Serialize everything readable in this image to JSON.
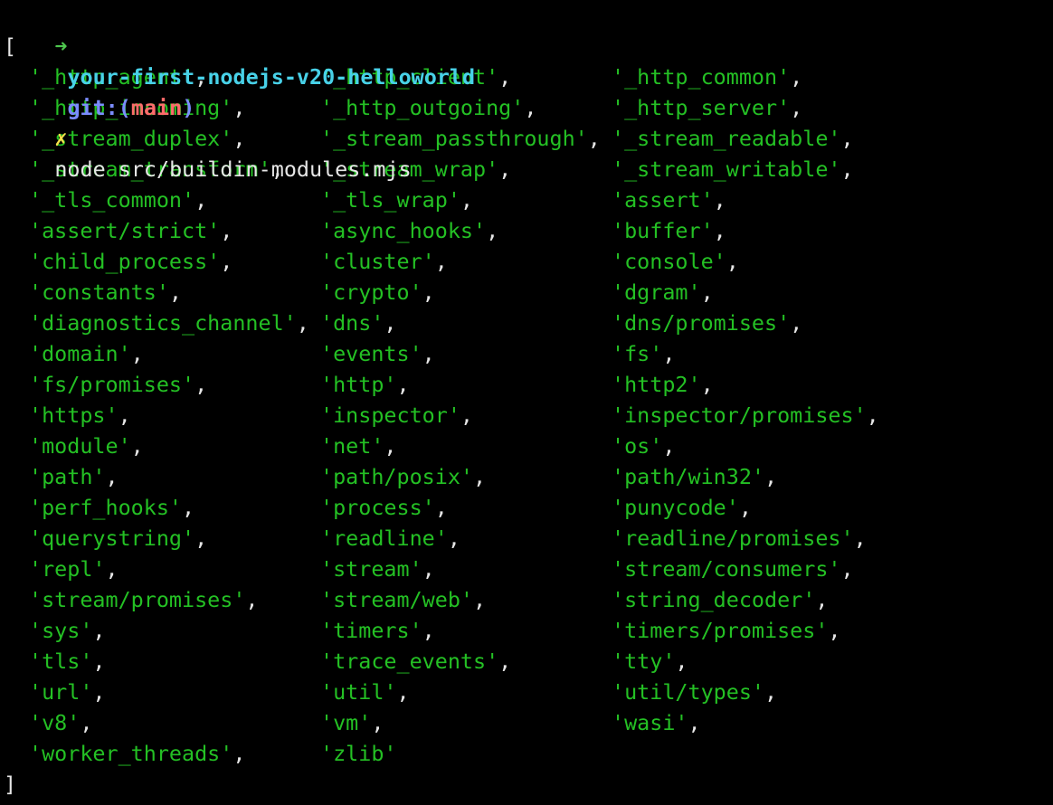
{
  "prompt": {
    "arrow": "➜",
    "directory": "your-first-nodejs-v20-helloworld",
    "git_label": "git:(",
    "branch": "main",
    "git_close": ")",
    "dirty_mark": "✗",
    "command": "node src/buildin-modules.mjs"
  },
  "output": {
    "open_bracket": "[",
    "close_bracket": "]",
    "modules": [
      "'_http_agent'",
      "'_http_client'",
      "'_http_common'",
      "'_http_incoming'",
      "'_http_outgoing'",
      "'_http_server'",
      "'_stream_duplex'",
      "'_stream_passthrough'",
      "'_stream_readable'",
      "'_stream_transform'",
      "'_stream_wrap'",
      "'_stream_writable'",
      "'_tls_common'",
      "'_tls_wrap'",
      "'assert'",
      "'assert/strict'",
      "'async_hooks'",
      "'buffer'",
      "'child_process'",
      "'cluster'",
      "'console'",
      "'constants'",
      "'crypto'",
      "'dgram'",
      "'diagnostics_channel'",
      "'dns'",
      "'dns/promises'",
      "'domain'",
      "'events'",
      "'fs'",
      "'fs/promises'",
      "'http'",
      "'http2'",
      "'https'",
      "'inspector'",
      "'inspector/promises'",
      "'module'",
      "'net'",
      "'os'",
      "'path'",
      "'path/posix'",
      "'path/win32'",
      "'perf_hooks'",
      "'process'",
      "'punycode'",
      "'querystring'",
      "'readline'",
      "'readline/promises'",
      "'repl'",
      "'stream'",
      "'stream/consumers'",
      "'stream/promises'",
      "'stream/web'",
      "'string_decoder'",
      "'sys'",
      "'timers'",
      "'timers/promises'",
      "'tls'",
      "'trace_events'",
      "'tty'",
      "'url'",
      "'util'",
      "'util/types'",
      "'v8'",
      "'vm'",
      "'wasi'",
      "'worker_threads'",
      "'zlib'"
    ],
    "separator": ","
  },
  "colors": {
    "background": "#000000",
    "string": "#24c024",
    "directory": "#48d1e8",
    "branch": "#ff6b6b",
    "git": "#7b8cff",
    "dirty_mark": "#f5e14b"
  }
}
